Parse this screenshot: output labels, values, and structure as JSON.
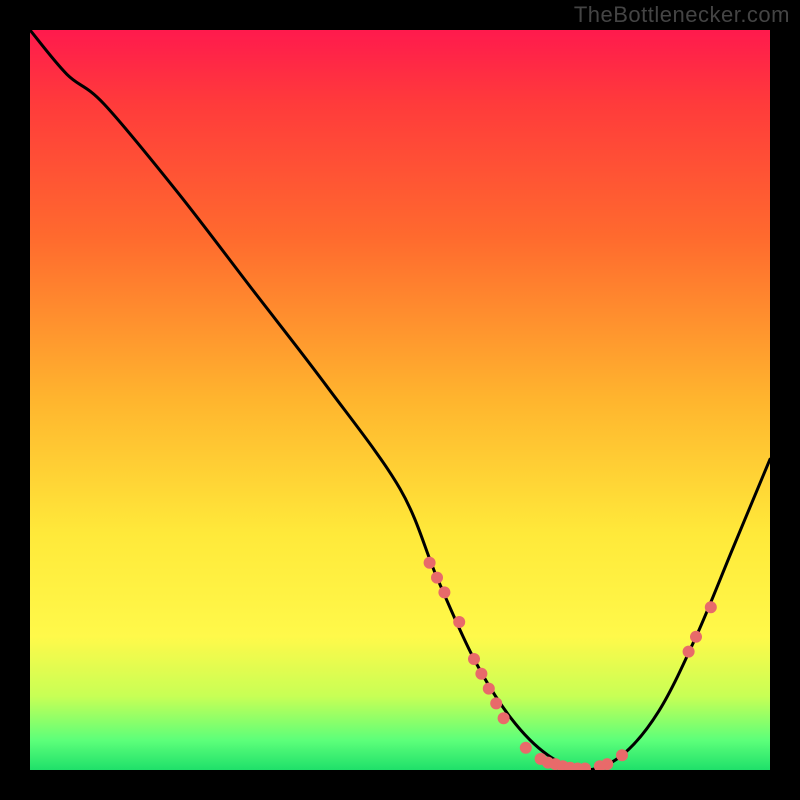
{
  "watermark": "TheBottlenecker.com",
  "chart_data": {
    "type": "line",
    "title": "",
    "xlabel": "",
    "ylabel": "",
    "xlim": [
      0,
      100
    ],
    "ylim": [
      0,
      100
    ],
    "grid": false,
    "legend": false,
    "background_gradient": [
      "#ff1a4d",
      "#ffe93a",
      "#1fe06a"
    ],
    "series": [
      {
        "name": "curve",
        "color": "#000000",
        "x": [
          0,
          5,
          10,
          20,
          30,
          40,
          50,
          55,
          60,
          65,
          70,
          75,
          80,
          85,
          90,
          95,
          100
        ],
        "y": [
          100,
          94,
          90,
          78,
          65,
          52,
          38,
          26,
          15,
          7,
          2,
          0,
          2,
          8,
          18,
          30,
          42
        ]
      }
    ],
    "markers": {
      "color": "#e86a6a",
      "radius": 6,
      "points": [
        {
          "x": 54,
          "y": 28
        },
        {
          "x": 55,
          "y": 26
        },
        {
          "x": 56,
          "y": 24
        },
        {
          "x": 58,
          "y": 20
        },
        {
          "x": 60,
          "y": 15
        },
        {
          "x": 61,
          "y": 13
        },
        {
          "x": 62,
          "y": 11
        },
        {
          "x": 63,
          "y": 9
        },
        {
          "x": 64,
          "y": 7
        },
        {
          "x": 67,
          "y": 3
        },
        {
          "x": 69,
          "y": 1.5
        },
        {
          "x": 70,
          "y": 1
        },
        {
          "x": 71,
          "y": 0.8
        },
        {
          "x": 72,
          "y": 0.5
        },
        {
          "x": 73,
          "y": 0.3
        },
        {
          "x": 74,
          "y": 0.2
        },
        {
          "x": 75,
          "y": 0.2
        },
        {
          "x": 77,
          "y": 0.5
        },
        {
          "x": 78,
          "y": 0.8
        },
        {
          "x": 80,
          "y": 2
        },
        {
          "x": 89,
          "y": 16
        },
        {
          "x": 90,
          "y": 18
        },
        {
          "x": 92,
          "y": 22
        }
      ]
    }
  }
}
